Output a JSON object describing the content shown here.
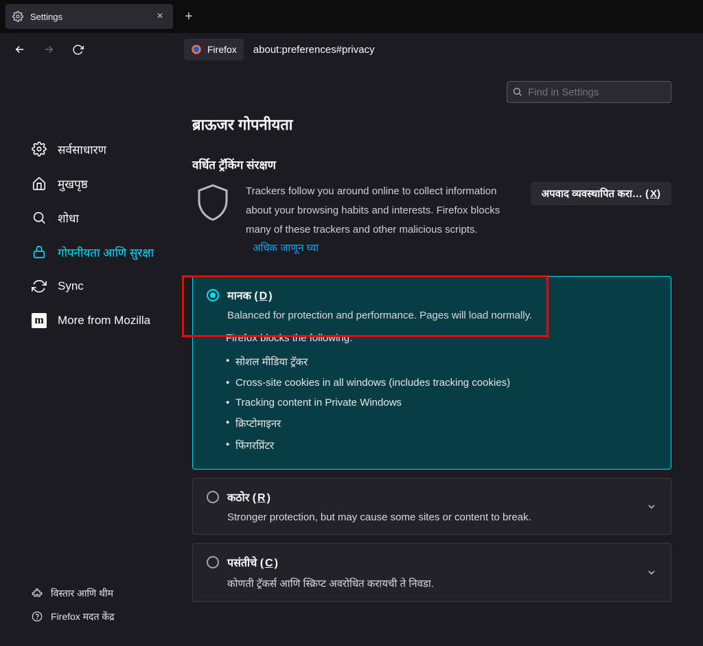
{
  "tab": {
    "title": "Settings"
  },
  "urlbar": {
    "chip": "Firefox",
    "url": "about:preferences#privacy"
  },
  "search": {
    "placeholder": "Find in Settings"
  },
  "sidebar": {
    "items": [
      {
        "label": "सर्वसाधारण"
      },
      {
        "label": "मुखपृष्ठ"
      },
      {
        "label": "शोधा"
      },
      {
        "label": "गोपनीयता आणि सुरक्षा"
      },
      {
        "label": "Sync"
      },
      {
        "label": "More from Mozilla"
      }
    ],
    "bottom": [
      {
        "label": "विस्तार आणि थीम"
      },
      {
        "label": "Firefox मदत केंद्र"
      }
    ]
  },
  "main": {
    "heading": "ब्राऊजर गोपनीयता",
    "subheading": "वर्धित ट्रॅकिंग संरक्षण",
    "intro": "Trackers follow you around online to collect information about your browsing habits and interests. Firefox blocks many of these trackers and other malicious scripts.",
    "learn_more": "अधिक जाणून घ्या",
    "manage_exceptions": "अपवाद व्यवस्थापित करा…",
    "manage_exceptions_accesskey": "X",
    "standard": {
      "title_pre": "मानक (",
      "title_ak": "D",
      "title_post": ")",
      "desc": "Balanced for protection and performance. Pages will load normally.",
      "blocks_heading": "Firefox blocks the following:",
      "blocks": [
        "सोशल मीडिया ट्रॅकर",
        "Cross-site cookies in all windows (includes tracking cookies)",
        "Tracking content in Private Windows",
        "क्रिप्टोमाइनर",
        "फिंगरप्रिंटर"
      ]
    },
    "strict": {
      "title_pre": "कठोर (",
      "title_ak": "R",
      "title_post": ")",
      "desc": "Stronger protection, but may cause some sites or content to break."
    },
    "custom": {
      "title_pre": "पसंतीचे (",
      "title_ak": "C",
      "title_post": ")",
      "desc": "कोणती ट्रॅकर्स आणि स्क्रिप्ट अवरोधित करायची ते निवडा."
    }
  }
}
